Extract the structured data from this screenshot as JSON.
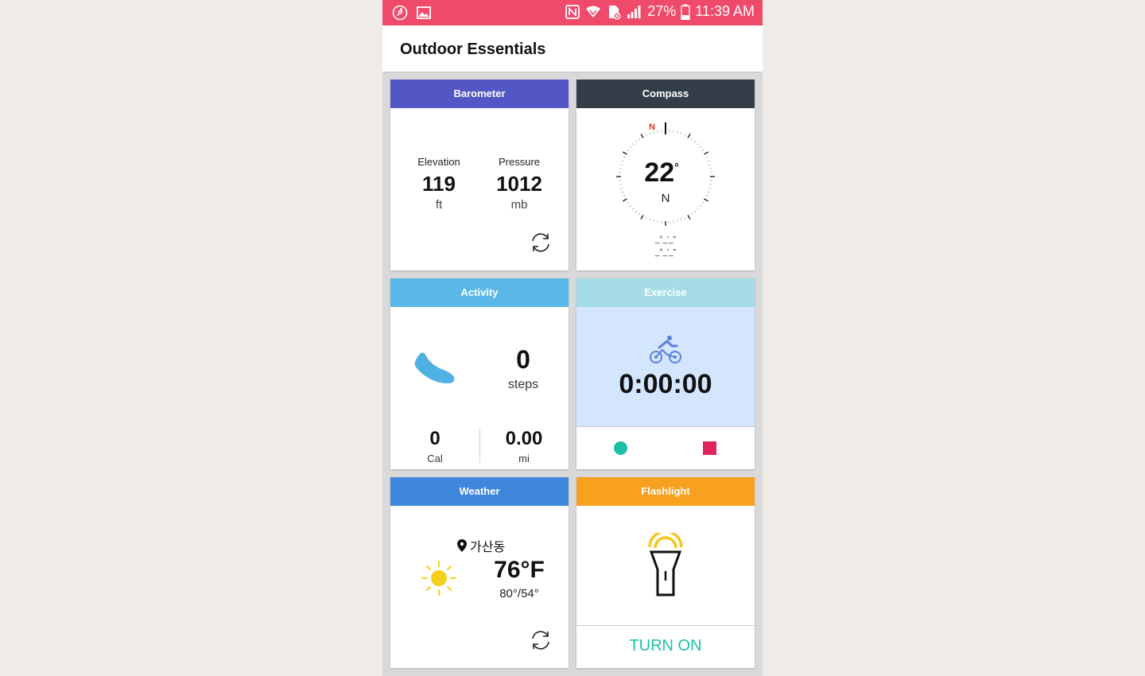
{
  "status_bar": {
    "battery": "27%",
    "time": "11:39 AM",
    "icons": [
      "run-icon",
      "image-icon",
      "nfc-icon",
      "wifi-icon",
      "no-sim-icon",
      "signal-icon",
      "battery-icon"
    ]
  },
  "app": {
    "title": "Outdoor Essentials"
  },
  "colors": {
    "status": "#ef4a6a",
    "barometer": "#5356c5",
    "compass": "#333d47",
    "activity": "#5ab8e8",
    "exercise": "#a6dce8",
    "weather": "#3f86dc",
    "flashlight": "#f8a11f",
    "turn_on": "#1fbfa6"
  },
  "barometer": {
    "title": "Barometer",
    "elevation_label": "Elevation",
    "elevation_value": "119",
    "elevation_unit": "ft",
    "pressure_label": "Pressure",
    "pressure_value": "1012",
    "pressure_unit": "mb"
  },
  "compass": {
    "title": "Compass",
    "degrees": "22",
    "degree_symbol": "°",
    "direction": "N",
    "north_marker": "N",
    "coord1": "_°_'_\"",
    "coord2": "_°_'_\""
  },
  "activity": {
    "title": "Activity",
    "steps_value": "0",
    "steps_label": "steps",
    "cal_value": "0",
    "cal_label": "Cal",
    "distance_value": "0.00",
    "distance_label": "mi"
  },
  "exercise": {
    "title": "Exercise",
    "timer": "0:00:00"
  },
  "weather": {
    "title": "Weather",
    "location": "가산동",
    "temperature": "76°F",
    "range": "80°/54°"
  },
  "flashlight": {
    "title": "Flashlight",
    "button_label": "TURN ON"
  }
}
